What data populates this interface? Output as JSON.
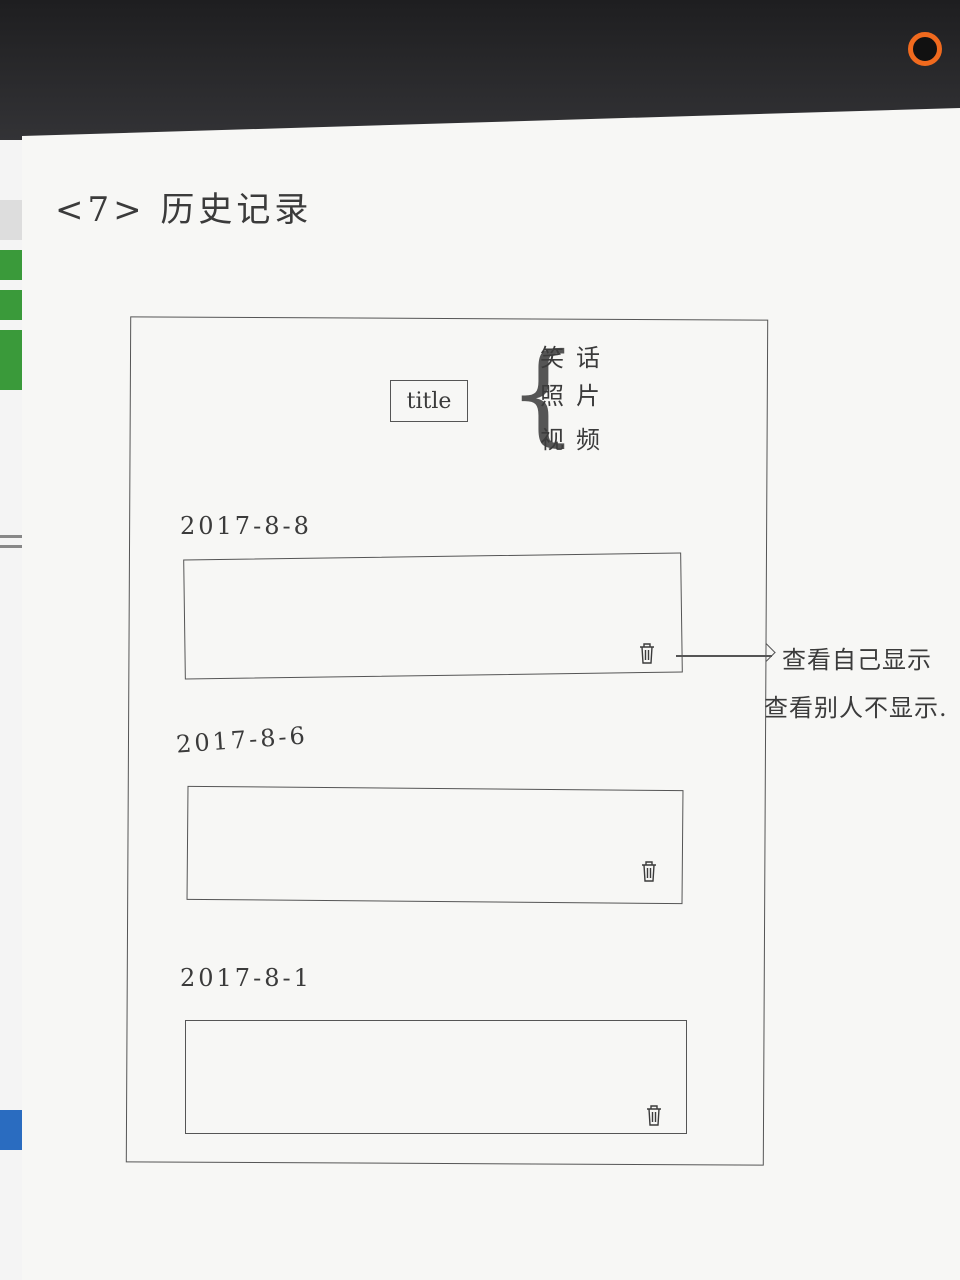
{
  "page": {
    "heading": "<7> 历史记录"
  },
  "wireframe": {
    "title_box_label": "title",
    "filter_options": [
      "笑话",
      "照片",
      "视频"
    ],
    "records": [
      {
        "date": "2017-8-8",
        "delete_icon": "trash-icon"
      },
      {
        "date": "2017-8-6",
        "delete_icon": "trash-icon"
      },
      {
        "date": "2017-8-1",
        "delete_icon": "trash-icon"
      }
    ]
  },
  "annotation": {
    "lines": [
      "查看自己显示",
      "查看别人不显示."
    ]
  },
  "colors": {
    "paper": "#f7f7f5",
    "ink": "#3b3b3b",
    "bezel": "#2a2a2c",
    "camera_ring": "#f06a1e"
  }
}
